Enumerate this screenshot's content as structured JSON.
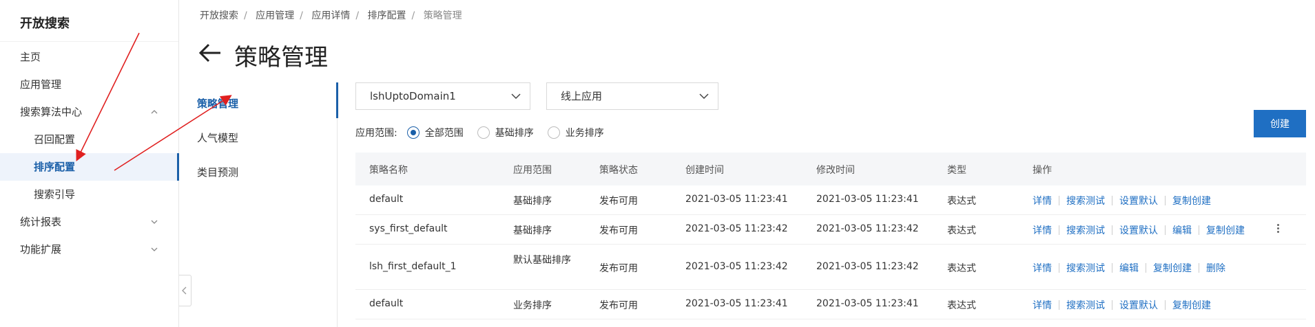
{
  "nav": {
    "title": "开放搜索",
    "items": [
      {
        "label": "主页"
      },
      {
        "label": "应用管理"
      },
      {
        "label": "搜索算法中心"
      },
      {
        "label": "召回配置"
      },
      {
        "label": "排序配置"
      },
      {
        "label": "搜索引导"
      },
      {
        "label": "统计报表"
      },
      {
        "label": "功能扩展"
      }
    ]
  },
  "breadcrumb": [
    "开放搜索",
    "应用管理",
    "应用详情",
    "排序配置",
    "策略管理"
  ],
  "page_title": "策略管理",
  "subnav": [
    "策略管理",
    "人气模型",
    "类目预测"
  ],
  "filters": {
    "app_select": "lshUptoDomain1",
    "env_select": "线上应用",
    "scope_label": "应用范围:",
    "scope_options": [
      "全部范围",
      "基础排序",
      "业务排序"
    ],
    "scope_selected": "全部范围"
  },
  "create_label": "创建",
  "table": {
    "headers": [
      "策略名称",
      "应用范围",
      "策略状态",
      "创建时间",
      "修改时间",
      "类型",
      "操作"
    ],
    "rows": [
      {
        "name": "default",
        "scope": "基础排序",
        "status": "发布可用",
        "created": "2021-03-05 11:23:41",
        "modified": "2021-03-05 11:23:41",
        "type": "表达式",
        "ops": [
          "详情",
          "搜索测试",
          "设置默认",
          "复制创建"
        ]
      },
      {
        "name": "sys_first_default",
        "scope": "基础排序",
        "status": "发布可用",
        "created": "2021-03-05 11:23:42",
        "modified": "2021-03-05 11:23:42",
        "type": "表达式",
        "ops": [
          "详情",
          "搜索测试",
          "设置默认",
          "编辑",
          "复制创建"
        ]
      },
      {
        "name": "lsh_first_default_1",
        "scope": "默认基础排序",
        "status": "发布可用",
        "created": "2021-03-05 11:23:42",
        "modified": "2021-03-05 11:23:42",
        "type": "表达式",
        "ops": [
          "详情",
          "搜索测试",
          "编辑",
          "复制创建",
          "删除"
        ]
      },
      {
        "name": "default",
        "scope": "业务排序",
        "status": "发布可用",
        "created": "2021-03-05 11:23:41",
        "modified": "2021-03-05 11:23:41",
        "type": "表达式",
        "ops": [
          "详情",
          "搜索测试",
          "设置默认",
          "复制创建"
        ]
      }
    ]
  },
  "colors": {
    "accent": "#1a5fa8",
    "annotation": "#e02020"
  }
}
